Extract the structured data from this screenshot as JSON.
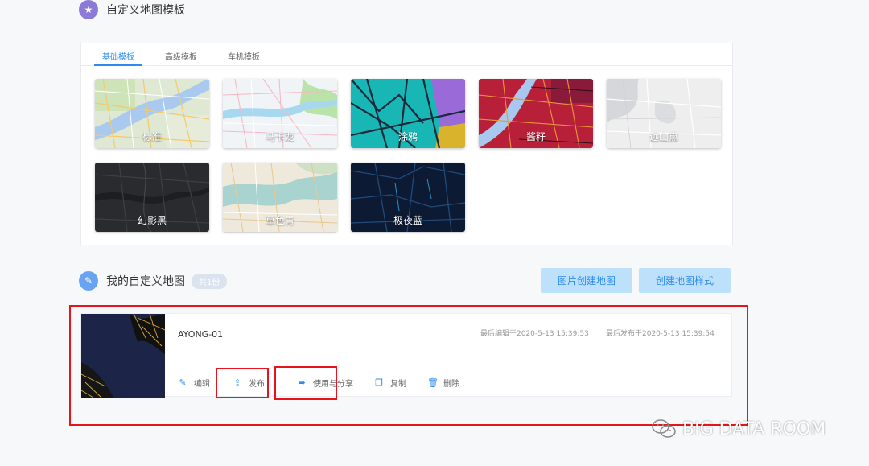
{
  "templates_section": {
    "title": "自定义地图模板",
    "icon": "star-icon"
  },
  "tabs": [
    {
      "label": "基础模板",
      "active": true
    },
    {
      "label": "高级模板",
      "active": false
    },
    {
      "label": "车机模板",
      "active": false
    }
  ],
  "templates": [
    {
      "label": "标准"
    },
    {
      "label": "马卡龙"
    },
    {
      "label": "涂鸦"
    },
    {
      "label": "酱籽"
    },
    {
      "label": "远山黛"
    },
    {
      "label": "幻影黑"
    },
    {
      "label": "草色青"
    },
    {
      "label": "极夜蓝"
    }
  ],
  "my_maps_section": {
    "title": "我的自定义地图",
    "count_badge": "共1份",
    "icon": "pencil-icon"
  },
  "buttons": {
    "create_from_image": "图片创建地图",
    "create_style": "创建地图样式"
  },
  "map_card": {
    "name": "AYONG-01",
    "last_edited": "最后编辑于2020-5-13 15:39:53",
    "last_published": "最后发布于2020-5-13 15:39:54",
    "actions": [
      {
        "label": "编辑",
        "icon": "pencil-icon"
      },
      {
        "label": "发布",
        "icon": "upload-icon"
      },
      {
        "label": "使用与分享",
        "icon": "share-icon"
      },
      {
        "label": "复制",
        "icon": "copy-icon"
      },
      {
        "label": "删除",
        "icon": "trash-icon"
      }
    ]
  },
  "watermark": {
    "text": "BIG DATA ROOM",
    "icon": "wechat-icon"
  },
  "colors": {
    "accent": "#2d8cf0",
    "highlight": "#e8141b",
    "button_bg": "#bde0fb"
  }
}
